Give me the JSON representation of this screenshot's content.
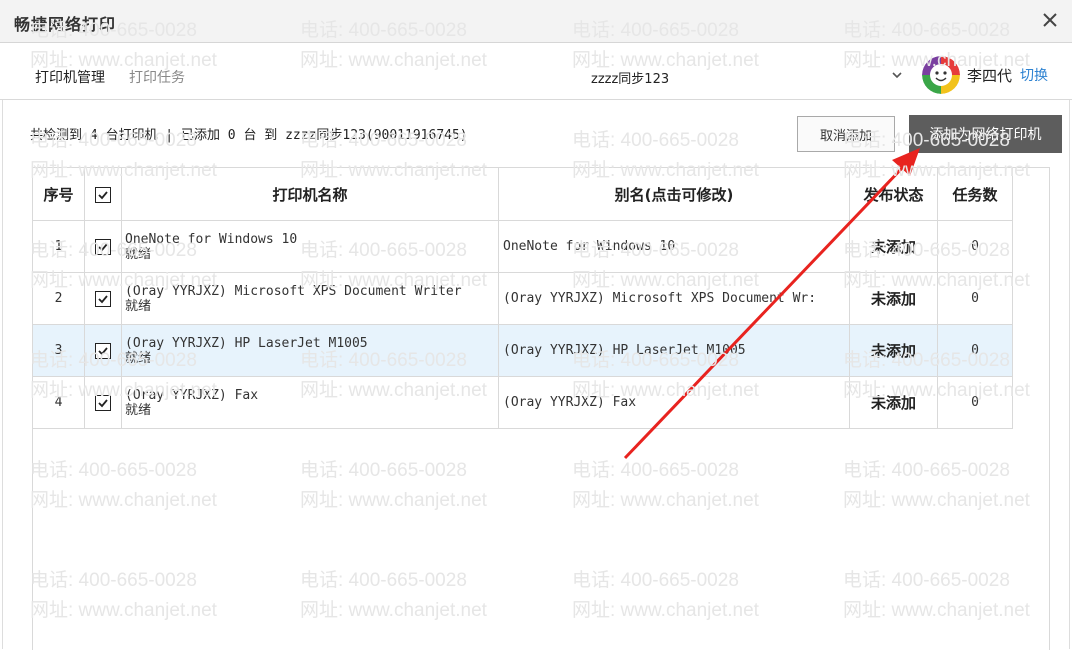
{
  "window": {
    "title": "畅捷网络打印"
  },
  "nav": {
    "tab_active": "打印机管理",
    "tab_inactive": "打印任务",
    "account": "zzzz同步123"
  },
  "user": {
    "name": "李四代",
    "switch_label": "切换"
  },
  "summary": "共检测到 4 台打印机 | 已添加 0 台 到 zzzz同步123(90011916745)",
  "buttons": {
    "cancel_label": "取消添加",
    "add_label": "添加为网络打印机"
  },
  "table": {
    "headers": {
      "num": "序号",
      "name": "打印机名称",
      "alias": "别名(点击可修改)",
      "publish": "发布状态",
      "tasks": "任务数"
    },
    "rows": [
      {
        "num": "1",
        "name": "OneNote for Windows 10",
        "status": "就绪",
        "alias": "OneNote for Windows 10",
        "publish": "未添加",
        "tasks": "0",
        "checked": true
      },
      {
        "num": "2",
        "name": "(Oray YYRJXZ) Microsoft XPS Document Writer",
        "status": "就绪",
        "alias": "(Oray YYRJXZ) Microsoft XPS Document Wr:",
        "publish": "未添加",
        "tasks": "0",
        "checked": true
      },
      {
        "num": "3",
        "name": "(Oray YYRJXZ) HP LaserJet M1005",
        "status": "就绪",
        "alias": "(Oray YYRJXZ) HP LaserJet M1005",
        "publish": "未添加",
        "tasks": "0",
        "checked": true,
        "selected": true
      },
      {
        "num": "4",
        "name": "(Oray YYRJXZ) Fax",
        "status": "就绪",
        "alias": "(Oray YYRJXZ) Fax",
        "publish": "未添加",
        "tasks": "0",
        "checked": true
      }
    ]
  },
  "watermark": {
    "phone": "电话: 400-665-0028",
    "site": "网址: www.chanjet.net"
  },
  "colors": {
    "add_button_bg": "#5d5d5d",
    "link_blue": "#2d82d1",
    "selected_row": "#e7f3fc",
    "arrow_red": "#e8231f"
  },
  "icons": {
    "close": "close-icon",
    "dropdown": "chevron-down-icon",
    "avatar": "avatar-icon",
    "checkbox": "checkbox-checked-icon"
  }
}
